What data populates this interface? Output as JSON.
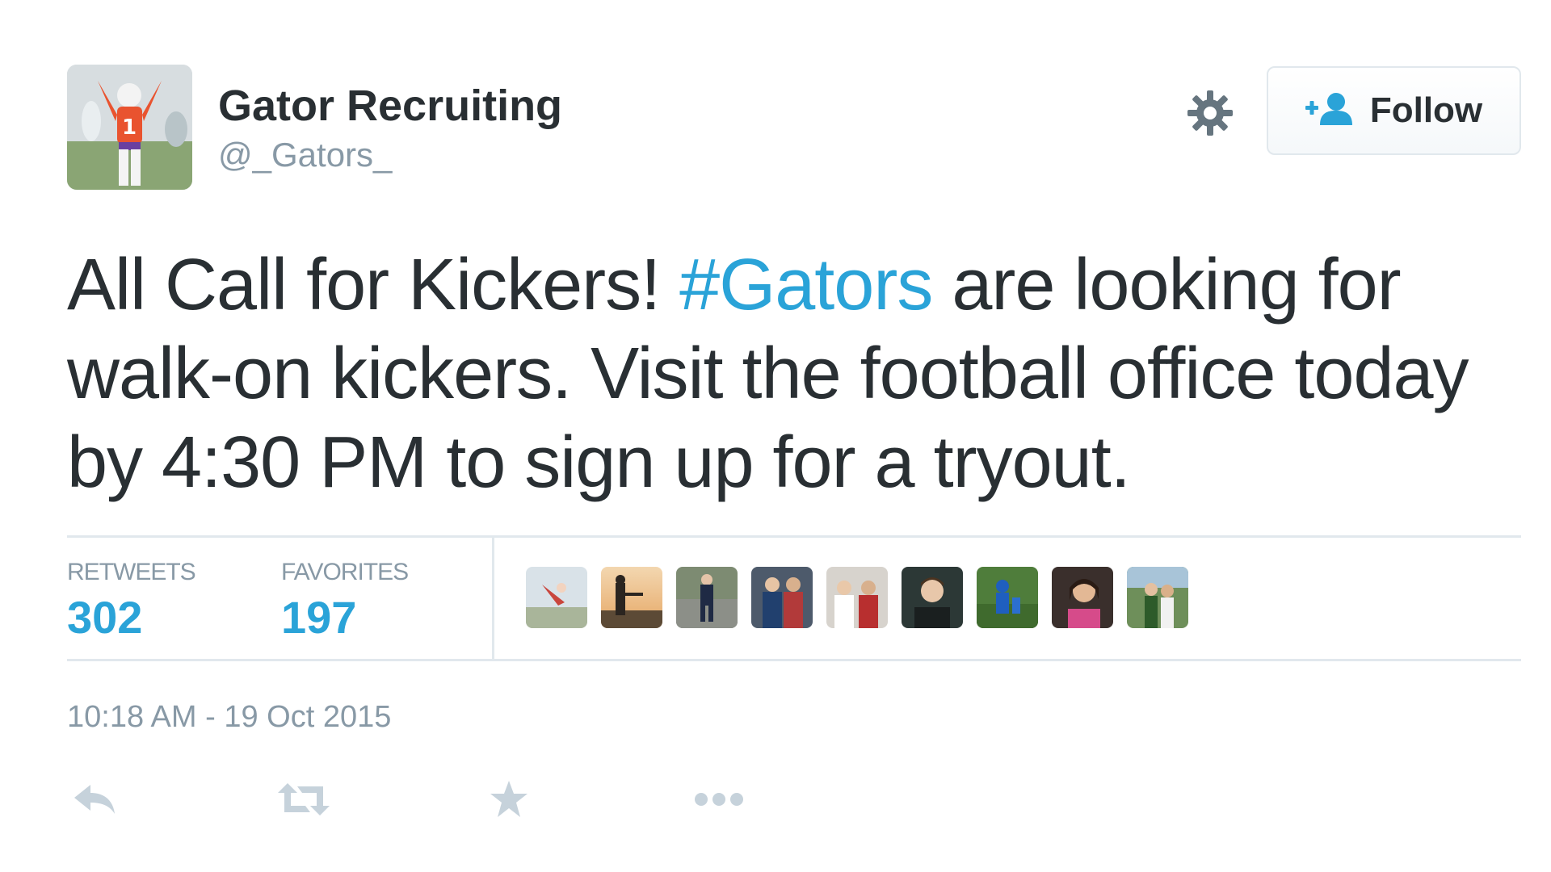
{
  "user": {
    "full_name": "Gator Recruiting",
    "username": "@_Gators_"
  },
  "follow_button": {
    "label": "Follow",
    "icon": "add-user-icon"
  },
  "tweet": {
    "text_before": "All Call for Kickers! ",
    "hashtag": "#Gators",
    "text_after": " are looking for walk-on kickers. Visit the football office today by 4:30 PM to sign up for a tryout."
  },
  "stats": {
    "retweets_label": "RETWEETS",
    "retweets_count": "302",
    "favorites_label": "FAVORITES",
    "favorites_count": "197"
  },
  "favorited_by_count_shown": 9,
  "timestamp": "10:18 AM - 19 Oct 2015",
  "actions": [
    "reply-icon",
    "retweet-icon",
    "favorite-icon",
    "more-icon"
  ],
  "colors": {
    "link": "#2aa3d8",
    "text": "#292f33",
    "muted": "#8899a6",
    "border": "#e1e8ed",
    "action_icon": "#c6d2db"
  }
}
